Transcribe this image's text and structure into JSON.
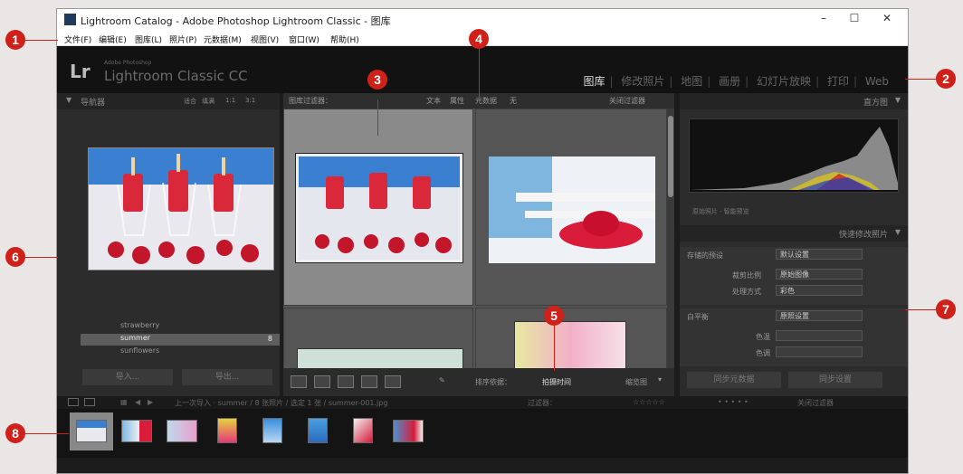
{
  "window": {
    "title": "Lightroom Catalog - Adobe Photoshop Lightroom Classic - 图库",
    "minimize": "–",
    "maximize": "☐",
    "close": "✕"
  },
  "menu": [
    "文件(F)",
    "编辑(E)",
    "图库(L)",
    "照片(P)",
    "元数据(M)",
    "视图(V)",
    "窗口(W)",
    "帮助(H)"
  ],
  "identity": {
    "logo": "Lr",
    "product_small": "Adobe Photoshop",
    "product": "Lightroom Classic CC"
  },
  "modules": [
    {
      "label": "图库",
      "active": true
    },
    {
      "label": "修改照片"
    },
    {
      "label": "地图"
    },
    {
      "label": "画册"
    },
    {
      "label": "幻灯片放映"
    },
    {
      "label": "打印"
    },
    {
      "label": "Web"
    }
  ],
  "left_panel": {
    "navigator_title": "导航器",
    "navigator_options": [
      "适合",
      "填满",
      "1:1",
      "3:1"
    ],
    "folders": [
      {
        "label": "strawberry"
      },
      {
        "label": "summer",
        "selected": true,
        "count": "8"
      },
      {
        "label": "sunflowers"
      }
    ],
    "import_button": "导入...",
    "export_button": "导出..."
  },
  "filter_bar": {
    "label": "图库过滤器：",
    "options": [
      "文本",
      "属性",
      "元数据",
      "无"
    ],
    "preset": "关闭过滤器"
  },
  "toolbar": {
    "sort_label": "排序依据：",
    "sort_value": "拍摄时间",
    "thumbs_label": "缩览图"
  },
  "right_panel": {
    "histogram_title": "直方图",
    "histogram_info": "原始照片 · 智能预览",
    "quick_develop_title": "快速修改照片",
    "saved_preset_label": "存储的预设",
    "saved_preset_value": "默认设置",
    "crop_label": "裁剪比例",
    "crop_value": "原始图像",
    "treatment_label": "处理方式",
    "treatment_value": "彩色",
    "wb_label": "白平衡",
    "wb_value": "原照设置",
    "temp_label": "色温",
    "tint_label": "色调",
    "sync_metadata": "同步元数据",
    "sync_settings": "同步设置"
  },
  "filmstrip_bar": {
    "source": "上一次导入 · summer / 8 张照片 / 选定 1 张 / summer-001.jpg",
    "filter_label": "过滤器：",
    "filter_value": "关闭过滤器"
  },
  "callouts": [
    "1",
    "2",
    "3",
    "4",
    "5",
    "6",
    "7",
    "8"
  ],
  "colors": {
    "accent_red": "#d0201a",
    "panel": "#2c2c2c",
    "center": "#555555"
  }
}
